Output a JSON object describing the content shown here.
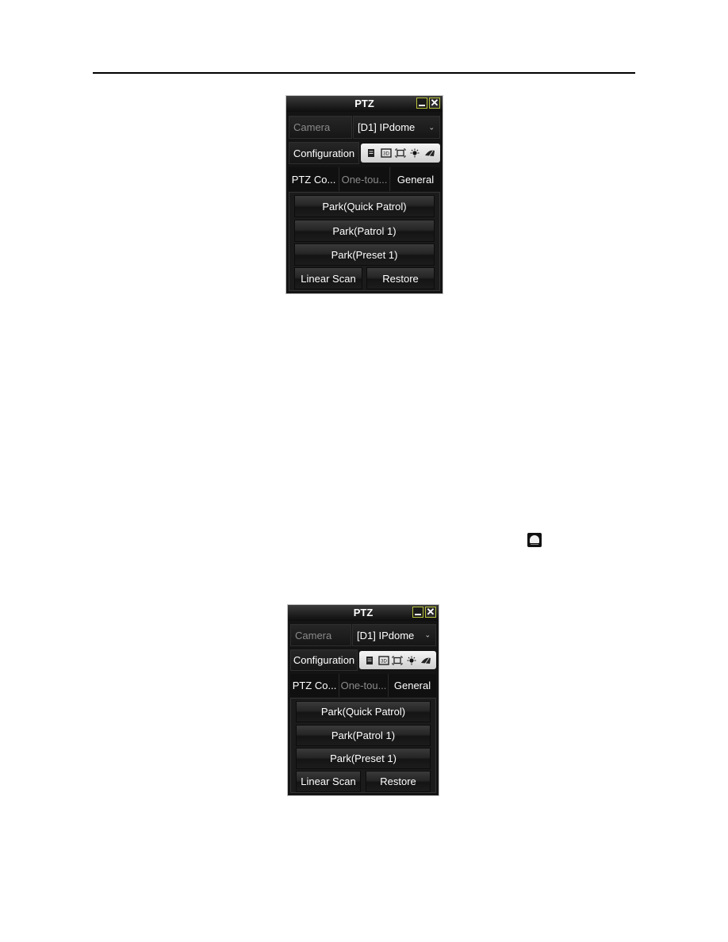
{
  "page": {
    "inline_icon": "ptz-dome-icon"
  },
  "panels": [
    {
      "title": "PTZ",
      "window_buttons": {
        "minimize": "minimize-icon",
        "close": "✕"
      },
      "camera_label": "Camera",
      "camera_value": "[D1] IPdome",
      "dropdown_icon": "⌄",
      "configuration_label": "Configuration",
      "toolbar_icons": [
        "menu-icon",
        "3d-zoom-icon",
        "zoom-area-icon",
        "light-icon",
        "wiper-icon"
      ],
      "tabs": [
        {
          "label": "PTZ Co...",
          "active": false
        },
        {
          "label": "One-tou...",
          "active": false,
          "dim": true
        },
        {
          "label": "General",
          "active": true
        }
      ],
      "buttons": {
        "quick_patrol": "Park(Quick Patrol)",
        "patrol1": "Park(Patrol 1)",
        "preset1": "Park(Preset 1)",
        "linear_scan": "Linear Scan",
        "restore": "Restore"
      }
    },
    {
      "title": "PTZ",
      "window_buttons": {
        "minimize": "minimize-icon",
        "close": "✕"
      },
      "camera_label": "Camera",
      "camera_value": "[D1] IPdome",
      "dropdown_icon": "⌄",
      "configuration_label": "Configuration",
      "toolbar_icons": [
        "menu-icon",
        "3d-zoom-icon",
        "zoom-area-icon",
        "light-icon",
        "wiper-icon"
      ],
      "tabs": [
        {
          "label": "PTZ Co...",
          "active": false
        },
        {
          "label": "One-tou...",
          "active": false,
          "dim": true
        },
        {
          "label": "General",
          "active": true
        }
      ],
      "buttons": {
        "quick_patrol": "Park(Quick Patrol)",
        "patrol1": "Park(Patrol 1)",
        "preset1": "Park(Preset 1)",
        "linear_scan": "Linear Scan",
        "restore": "Restore"
      }
    }
  ]
}
